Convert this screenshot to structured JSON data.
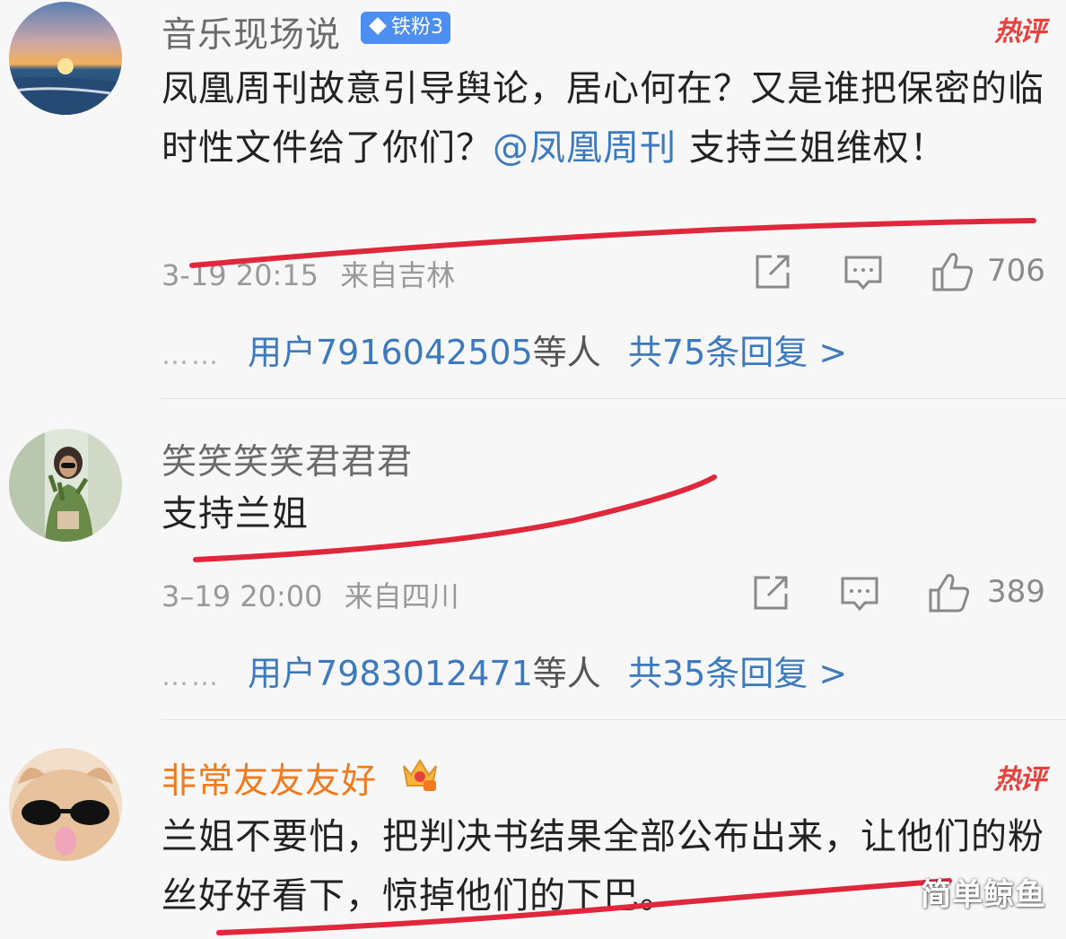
{
  "comments": [
    {
      "username": "音乐现场说",
      "badge": "铁粉3",
      "hot_label": "热评",
      "text_before": "凤凰周刊故意引导舆论，居心何在？又是谁把保密的临时性文件给了你们？",
      "mention": "@凤凰周刊",
      "text_after": " 支持兰姐维权！",
      "timestamp": "3-19 20:15",
      "location": "来自吉林",
      "likes": "706",
      "replies_dots": "……",
      "replies_user": "用户7916042505",
      "replies_suffix": "等人",
      "replies_count": "共75条回复 >"
    },
    {
      "username": "笑笑笑笑君君君",
      "text": "支持兰姐",
      "timestamp": "3–19 20:00",
      "location": "来自四川",
      "likes": "389",
      "replies_dots": "……",
      "replies_user": "用户7983012471",
      "replies_suffix": "等人",
      "replies_count": "共35条回复 >"
    },
    {
      "username": "非常友友友好",
      "hot_label": "热评",
      "text": "兰姐不要怕，把判决书结果全部公布出来，让他们的粉丝好好看下，惊掉他们的下巴。"
    }
  ],
  "icons": {
    "share": "share-icon",
    "comment": "comment-icon",
    "like": "thumbs-up-icon",
    "crown": "crown-badge-icon"
  },
  "colors": {
    "link_blue": "#3d79bd",
    "hot_red": "#e8413d",
    "vip_orange": "#f07a1e",
    "marker_red": "#e0283c"
  },
  "watermark": "简单鲸鱼"
}
